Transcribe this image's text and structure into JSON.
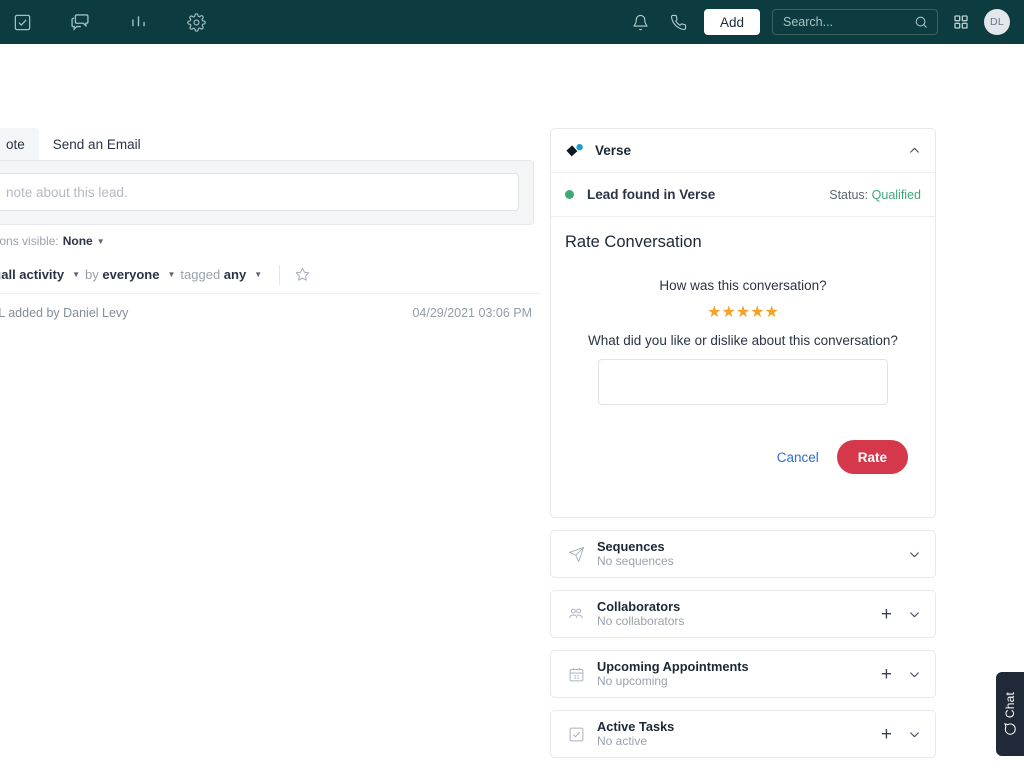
{
  "topbar": {
    "nav_icons": [
      {
        "name": "tasks-checkbox-icon",
        "label": "Tasks"
      },
      {
        "name": "messages-icon",
        "label": "Messages"
      },
      {
        "name": "reports-bar-chart-icon",
        "label": "Reports"
      },
      {
        "name": "settings-gear-icon",
        "label": "Settings"
      }
    ],
    "bell_label": "Notifications",
    "phone_label": "Call",
    "add_label": "Add",
    "search_placeholder": "Search...",
    "apps_label": "Apps",
    "avatar_initials": "DL",
    "bg_color": "#0d3c40"
  },
  "left": {
    "tabs": [
      {
        "label": "ote",
        "active": true
      },
      {
        "label": "Send an Email",
        "active": false
      }
    ],
    "composer_placeholder": "note about this lead.",
    "visibility": {
      "label": "ersations visible:",
      "value": "None"
    },
    "filters": {
      "prefix": "g",
      "activity": "all activity",
      "by_label": "by",
      "by_value": "everyone",
      "tagged_label": "tagged",
      "tagged_value": "any"
    },
    "activity": {
      "text": "l L added by Daniel Levy",
      "timestamp": "04/29/2021 03:06 PM"
    }
  },
  "verse_card": {
    "title": "Verse",
    "status_label": "Lead found in Verse",
    "status_prefix": "Status:",
    "status_value": "Qualified",
    "status_color": "#3fa978",
    "rate_title": "Rate Conversation",
    "question_1": "How was this conversation?",
    "stars": "★★★★★",
    "rating_value": 5,
    "rating_max": 5,
    "star_color": "#f5a227",
    "question_2": "What did you like or dislike about this conversation?",
    "feedback_value": "",
    "cancel_label": "Cancel",
    "rate_label": "Rate",
    "rate_btn_color": "#d5384a",
    "cancel_color": "#2a6ed8"
  },
  "sections": [
    {
      "name": "sequences",
      "icon": "paper-plane-icon",
      "title": "Sequences",
      "subtitle": "No sequences",
      "has_add": false
    },
    {
      "name": "collaborators",
      "icon": "people-icon",
      "title": "Collaborators",
      "subtitle": "No collaborators",
      "has_add": true
    },
    {
      "name": "upcoming-appointments",
      "icon": "calendar-icon",
      "title": "Upcoming Appointments",
      "subtitle": "No upcoming",
      "has_add": true
    },
    {
      "name": "active-tasks",
      "icon": "checkbox-icon",
      "title": "Active Tasks",
      "subtitle": "No active",
      "has_add": true
    }
  ],
  "chat_widget": {
    "label": "Chat",
    "bg_color": "#1f2937"
  }
}
